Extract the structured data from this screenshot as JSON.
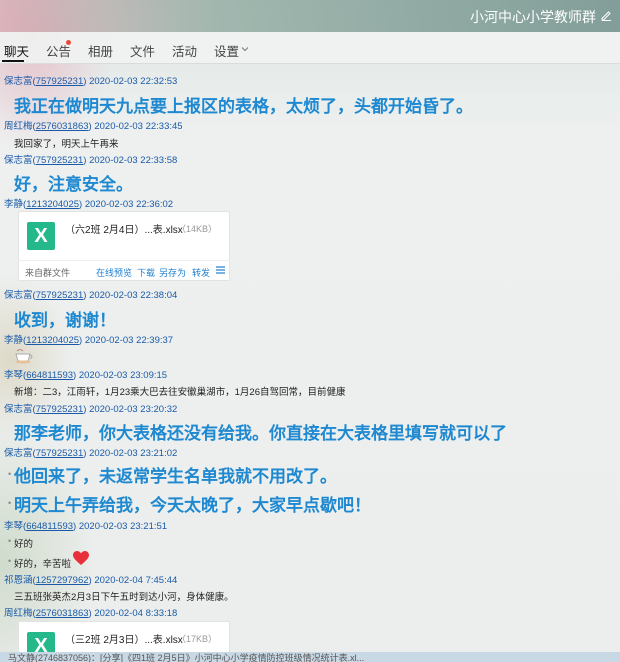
{
  "window": {
    "group_name": "小河中心小学教师群"
  },
  "tabs": [
    {
      "label": "聊天",
      "active": true
    },
    {
      "label": "公告",
      "has_dot": true
    },
    {
      "label": "相册"
    },
    {
      "label": "文件"
    },
    {
      "label": "活动"
    },
    {
      "label": "设置"
    }
  ],
  "colors": {
    "accent_text": "#1e88d0",
    "link": "#1a5aa8",
    "file_green": "#25b88b",
    "dot_red": "#e84b3c"
  },
  "messages": [
    {
      "sender": "保志富",
      "uid": "757925231",
      "time": "2020-02-03 22:32:53",
      "text": "我正在做明天九点要上报区的表格，太烦了，头都开始昏了。"
    },
    {
      "sender": "周红梅",
      "uid": "2576031863",
      "time": "2020-02-03 22:33:45",
      "text": "我回家了，明天上午再来"
    },
    {
      "sender": "保志富",
      "uid": "757925231",
      "time": "2020-02-03 22:33:58",
      "text": "好，注意安全。"
    },
    {
      "sender": "李静",
      "uid": "1213204025",
      "time": "2020-02-03 22:36:02",
      "file": {
        "name": "（六2班 2月4日）...表.xlsx",
        "size": "（14KB）",
        "from": "来自群文件",
        "actions": [
          "在线预览",
          "下载",
          "另存为",
          "转发"
        ]
      }
    },
    {
      "sender": "保志富",
      "uid": "757925231",
      "time": "2020-02-03 22:38:04",
      "text": "收到，谢谢！"
    },
    {
      "sender": "李静",
      "uid": "1213204025",
      "time": "2020-02-03 22:39:37",
      "emoji": "coffee-cup"
    },
    {
      "sender": "李琴",
      "uid": "664811593",
      "time": "2020-02-03 23:09:15",
      "text": "新增：二3，江雨轩，1月23乘大巴去往安徽巢湖市，1月26自驾回常，目前健康"
    },
    {
      "sender": "保志富",
      "uid": "757925231",
      "time": "2020-02-03 23:20:32",
      "text": "那李老师，你大表格还没有给我。你直接在大表格里填写就可以了"
    },
    {
      "sender": "保志富",
      "uid": "757925231",
      "time": "2020-02-03 23:21:02",
      "lines": [
        "他回来了，未返常学生名单我就不用改了。",
        "明天上午弄给我，今天太晚了，大家早点歇吧！"
      ]
    },
    {
      "sender": "李琴",
      "uid": "664811593",
      "time": "2020-02-03 23:21:51",
      "lines": [
        "好的",
        "好的，辛苦啦"
      ]
    },
    {
      "sender": "祁恩涵",
      "uid": "1257297962",
      "time": "2020-02-04 7:45:44",
      "text": "三五班张英杰2月3日下午五时到达小河，身体健康。"
    },
    {
      "sender": "周红梅",
      "uid": "2576031863",
      "time": "2020-02-04 8:33:18",
      "file": {
        "name": "（三2班 2月3日）...表.xlsx",
        "size": "（17KB）"
      }
    }
  ],
  "cut_line": "一 七 七 六 十 下",
  "status_bar": "马文静(2746837056)：[分享]《四1班 2月5日》小河中心小学疫情防控班级情况统计表.xl..."
}
